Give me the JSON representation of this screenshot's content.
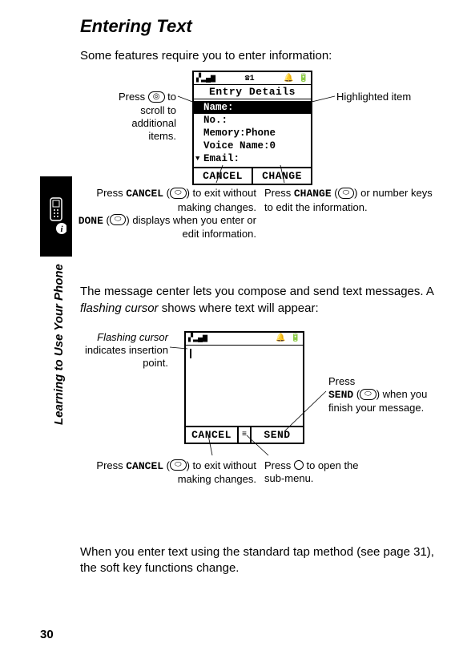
{
  "page_number": "30",
  "side_label": "Learning to Use Your Phone",
  "heading": "Entering Text",
  "intro": "Some features require you to enter information:",
  "fig1": {
    "phone": {
      "status_left": "▞▂▄▆",
      "status_mid": "☎1",
      "status_right": "🔔 🔋",
      "title": "Entry Details",
      "rows": {
        "r1": "Name:",
        "r2": "No.:",
        "r3": "Memory:Phone",
        "r4": "Voice Name:0",
        "r5": "Email:"
      },
      "soft_left": "CANCEL",
      "soft_right": "CHANGE"
    },
    "callouts": {
      "scroll": "Press ⵙ to scroll to additional items.",
      "highlighted": "Highlighted item",
      "cancel_a": "Press ",
      "cancel_soft": "CANCEL",
      "cancel_b": " (",
      "cancel_c": ") to exit without making changes. ",
      "done_soft": "DONE",
      "cancel_d": " (",
      "cancel_e": ") displays when you enter or edit information.",
      "change_a": "Press ",
      "change_soft": "CHANGE",
      "change_b": " (",
      "change_c": ") or number keys to edit the information."
    }
  },
  "mid_text_a": "The message center lets you compose and send text messages. A ",
  "mid_text_i": "flashing cursor",
  "mid_text_b": " shows where text will appear:",
  "fig2": {
    "phone": {
      "status_left": "▞▂▄▆",
      "status_right": "🔔 🔋",
      "soft_left": "CANCEL",
      "soft_right": "SEND"
    },
    "callouts": {
      "cursor_a": "Flashing cursor",
      "cursor_b": " indicates insertion point.",
      "send_a": "Press ",
      "send_soft": "SEND",
      "send_b": " (",
      "send_c": ") when you finish your message.",
      "cancel2_a": "Press ",
      "cancel2_soft": "CANCEL",
      "cancel2_b": " (",
      "cancel2_c": ") to exit without making changes.",
      "submenu_a": "Press ⊛ to open the sub-menu."
    }
  },
  "outro": "When you enter text using the standard tap method (see page 31), the soft key functions change."
}
